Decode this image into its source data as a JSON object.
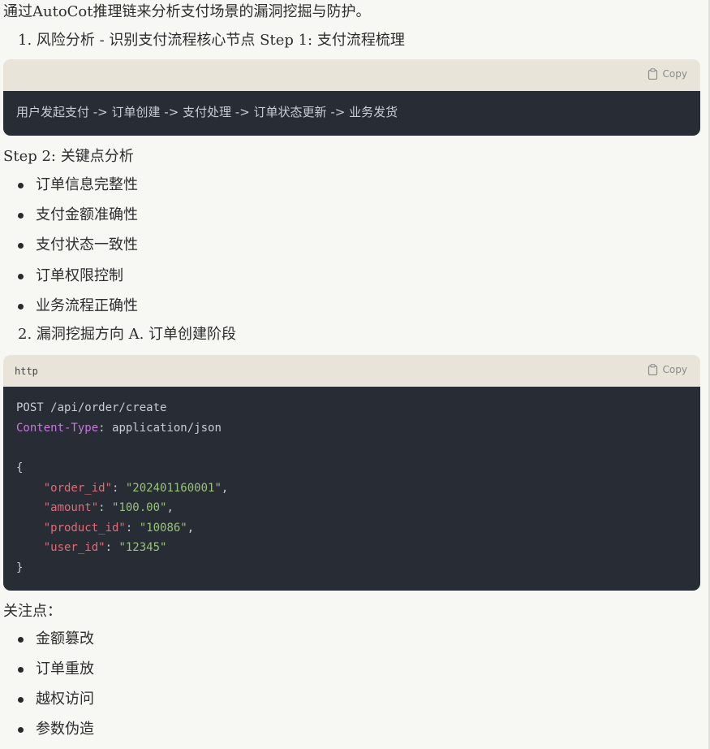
{
  "intro": "通过AutoCot推理链来分析支付场景的漏洞挖掘与防护。",
  "section1": "1. 风险分析 - 识别支付流程核心节点 Step 1: 支付流程梳理",
  "code1": {
    "lang": "",
    "copy_label": "Copy",
    "line": "用户发起支付 -> 订单创建 -> 支付处理 -> 订单状态更新 -> 业务发货"
  },
  "step2": "Step 2: 关键点分析",
  "keypoints": [
    "订单信息完整性",
    "支付金额准确性",
    "支付状态一致性",
    "订单权限控制",
    "业务流程正确性"
  ],
  "section2": "2. 漏洞挖掘方向 A. 订单创建阶段",
  "code2": {
    "lang": "http",
    "copy_label": "Copy",
    "request_line": "POST /api/order/create",
    "header_key": "Content-Type",
    "header_value": "application/json",
    "open_brace": "{",
    "close_brace": "}",
    "fields": [
      {
        "key": "\"order_id\"",
        "value": "\"202401160001\"",
        "trail": ","
      },
      {
        "key": "\"amount\"",
        "value": "\"100.00\"",
        "trail": ","
      },
      {
        "key": "\"product_id\"",
        "value": "\"10086\"",
        "trail": ","
      },
      {
        "key": "\"user_id\"",
        "value": "\"12345\"",
        "trail": ""
      }
    ]
  },
  "focus_title": "关注点：",
  "focus_points": [
    "金额篡改",
    "订单重放",
    "越权访问",
    "参数伪造"
  ]
}
